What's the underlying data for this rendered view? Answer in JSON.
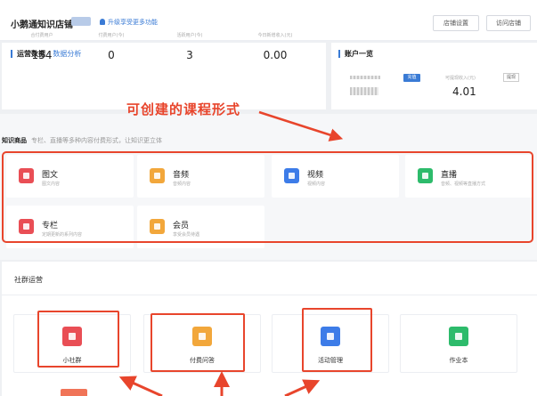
{
  "header": {
    "shop_name": "小鹅通知识店铺",
    "upgrade_text": "升级享受更多功能",
    "settings_button": "店铺设置",
    "visit_button": "访问店铺"
  },
  "operation": {
    "title": "运营数据",
    "subtitle": "- 数据分析",
    "stats": [
      {
        "label": "合付费用户",
        "value": "154"
      },
      {
        "label": "付费用户(今)",
        "value": "0"
      },
      {
        "label": "活跃用户(今)",
        "value": "3"
      },
      {
        "label": "今日新增收入(元)",
        "value": "0.00"
      }
    ]
  },
  "account": {
    "title": "账户一览",
    "chip": "充值",
    "withdraw_label": "可提现收入(元)",
    "withdraw_value": "4.01",
    "withdraw_button": "提现"
  },
  "annotation": "可创建的课程形式",
  "knowledge": {
    "title": "知识商品",
    "subtitle": "专栏、直播等多种内容付费形式，让知识更立体",
    "cards": [
      {
        "name": "图文",
        "desc": "图文内容",
        "color": "#e94e55",
        "icon": "document-icon"
      },
      {
        "name": "音频",
        "desc": "音频内容",
        "color": "#f2a73b",
        "icon": "audio-icon"
      },
      {
        "name": "视频",
        "desc": "视频内容",
        "color": "#3d7ce8",
        "icon": "video-icon"
      },
      {
        "name": "直播",
        "desc": "音频、视频等直播方式",
        "color": "#2dbb6b",
        "icon": "live-icon"
      },
      {
        "name": "专栏",
        "desc": "定期更新的系列内容",
        "color": "#e94e55",
        "icon": "column-icon"
      },
      {
        "name": "会员",
        "desc": "享受会员待遇",
        "color": "#f2a73b",
        "icon": "crown-icon"
      }
    ]
  },
  "community": {
    "title": "社群运营",
    "items": [
      {
        "name": "小社群",
        "color": "#e94e55",
        "icon": "people-icon"
      },
      {
        "name": "付费问答",
        "color": "#f2a73b",
        "icon": "qa-icon"
      },
      {
        "name": "活动管理",
        "color": "#3d7ce8",
        "icon": "flag-icon"
      },
      {
        "name": "作业本",
        "color": "#2dbb6b",
        "icon": "notebook-icon"
      }
    ]
  }
}
